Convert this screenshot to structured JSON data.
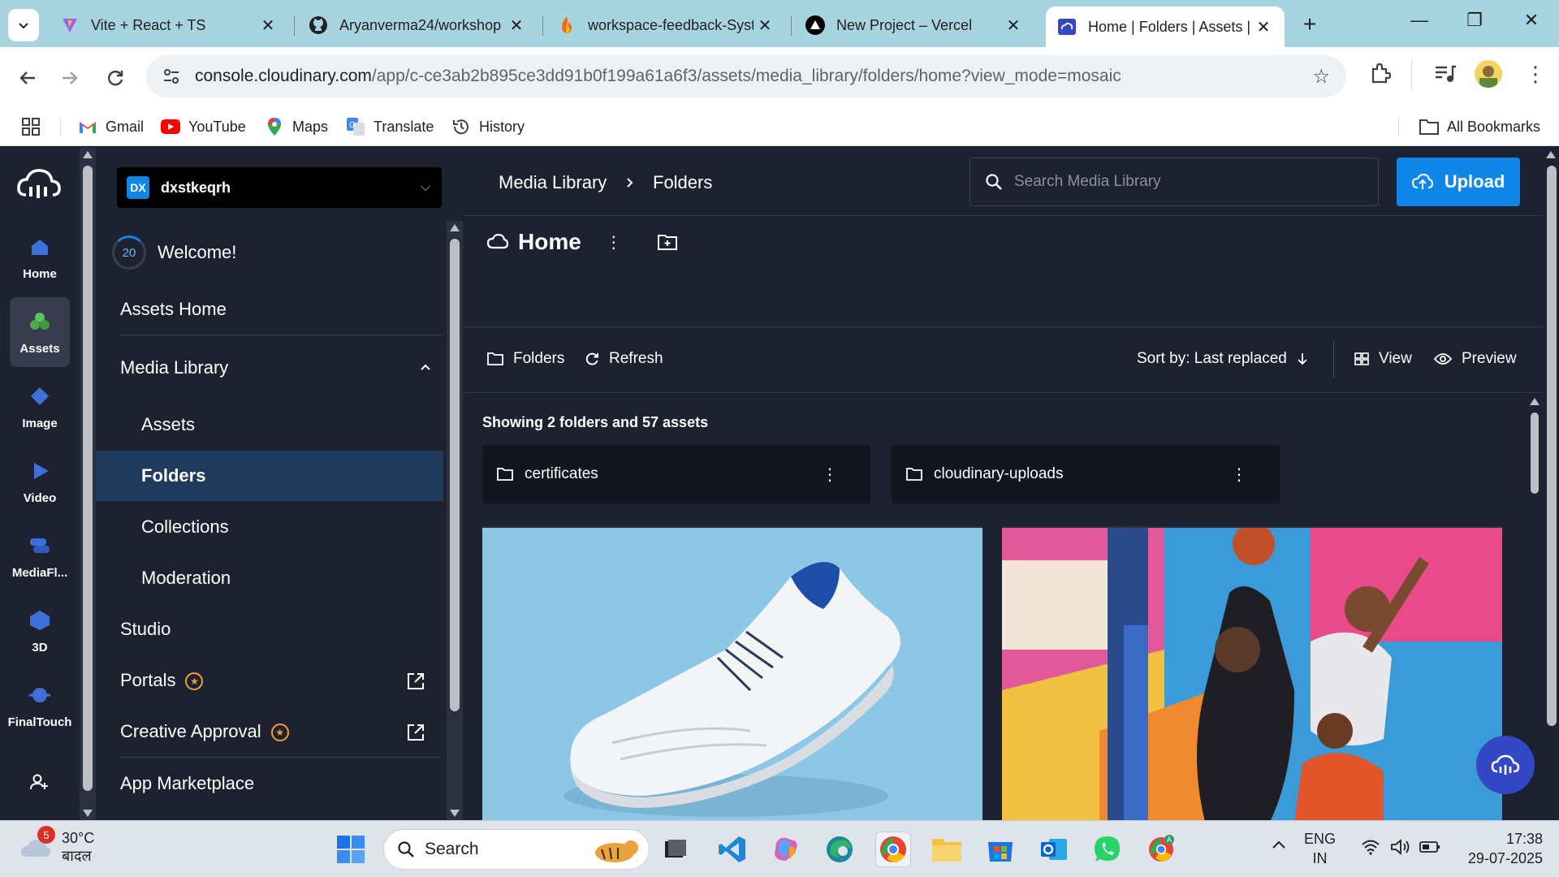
{
  "browser": {
    "tabs": [
      {
        "title": "Vite + React + TS",
        "icon": "vite-icon"
      },
      {
        "title": "Aryanverma24/workshop",
        "icon": "github-icon"
      },
      {
        "title": "workspace-feedback-Syst",
        "icon": "firebase-icon"
      },
      {
        "title": "New Project – Vercel",
        "icon": "vercel-icon"
      },
      {
        "title": "Home | Folders | Assets | C",
        "icon": "cloudinary-icon",
        "active": true
      }
    ],
    "url_host": "console.cloudinary.com",
    "url_path": "/app/c-ce3ab2b895ce3dd91b0f199a61a6f3/assets/media_library/folders/home?view_mode=mosaic",
    "bookmarks": [
      "Gmail",
      "YouTube",
      "Maps",
      "Translate",
      "History"
    ],
    "all_bookmarks": "All Bookmarks"
  },
  "rail": [
    {
      "label": "Home",
      "icon": "home-icon"
    },
    {
      "label": "Assets",
      "icon": "assets-icon",
      "active": true
    },
    {
      "label": "Image",
      "icon": "image-icon"
    },
    {
      "label": "Video",
      "icon": "video-icon"
    },
    {
      "label": "MediaFl...",
      "icon": "mediaflows-icon"
    },
    {
      "label": "3D",
      "icon": "3d-icon"
    },
    {
      "label": "FinalTouch",
      "icon": "finaltouch-icon"
    }
  ],
  "sidebar": {
    "env_badge": "DX",
    "env_name": "dxstkeqrh",
    "welcome_count": "20",
    "welcome_text": "Welcome!",
    "assets_home": "Assets Home",
    "media_library": "Media Library",
    "sub_items": [
      "Assets",
      "Folders",
      "Collections",
      "Moderation"
    ],
    "studio": "Studio",
    "portals": "Portals",
    "creative_approval": "Creative Approval",
    "app_marketplace": "App Marketplace"
  },
  "main": {
    "breadcrumb": [
      "Media Library",
      "Folders"
    ],
    "search_placeholder": "Search Media Library",
    "upload_label": "Upload",
    "title": "Home",
    "actions": {
      "folders": "Folders",
      "refresh": "Refresh",
      "sort": "Sort by: Last replaced",
      "view": "View",
      "preview": "Preview"
    },
    "showing": "Showing 2 folders and 57 assets",
    "folders": [
      "certificates",
      "cloudinary-uploads"
    ]
  },
  "taskbar": {
    "weather_badge": "5",
    "temp": "30°C",
    "condition": "बादल",
    "search": "Search",
    "lang1": "ENG",
    "lang2": "IN",
    "time": "17:38",
    "date": "29-07-2025"
  },
  "colors": {
    "accent": "#0f86e8",
    "app_bg": "#1e2230",
    "tabbar": "#a8d4df"
  }
}
